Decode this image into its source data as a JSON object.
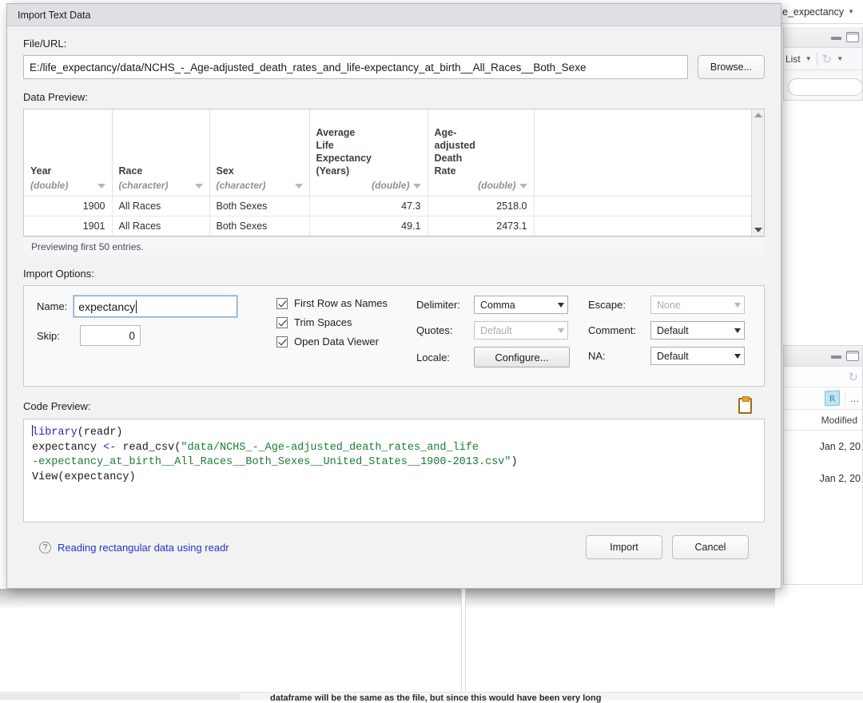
{
  "background": {
    "top_tab_label": "e_expectancy",
    "env_toolbar_label": "List",
    "files_modified_header": "Modified",
    "files_rows": [
      "Jan 2, 20",
      "Jan 2, 20"
    ],
    "bottom_text": "dataframe will be the same as the file, but since this would have been very long",
    "r_logo_letter": "R",
    "more_dots": "..."
  },
  "dialog": {
    "title": "Import Text Data",
    "file_url": {
      "label": "File/URL:",
      "value": "E:/life_expectancy/data/NCHS_-_Age-adjusted_death_rates_and_life-expectancy_at_birth__All_Races__Both_Sexe",
      "browse_label": "Browse..."
    },
    "data_preview": {
      "label": "Data Preview:",
      "columns": [
        {
          "name": "Year",
          "type": "(double)",
          "numeric": true
        },
        {
          "name": "Race",
          "type": "(character)",
          "numeric": false
        },
        {
          "name": "Sex",
          "type": "(character)",
          "numeric": false
        },
        {
          "name": "Average\nLife\nExpectancy\n(Years)",
          "type": "(double)",
          "numeric": true
        },
        {
          "name": "Age-\nadjusted\nDeath\nRate",
          "type": "(double)",
          "numeric": true
        }
      ],
      "rows": [
        {
          "year": "1900",
          "race": "All Races",
          "sex": "Both Sexes",
          "life_expectancy": "47.3",
          "death_rate": "2518.0"
        },
        {
          "year": "1901",
          "race": "All Races",
          "sex": "Both Sexes",
          "life_expectancy": "49.1",
          "death_rate": "2473.1"
        }
      ],
      "footer": "Previewing first 50 entries."
    },
    "import_options": {
      "label": "Import Options:",
      "name_label": "Name:",
      "name_value": "expectancy",
      "skip_label": "Skip:",
      "skip_value": "0",
      "checkboxes": [
        {
          "label": "First Row as Names",
          "checked": true
        },
        {
          "label": "Trim Spaces",
          "checked": true
        },
        {
          "label": "Open Data Viewer",
          "checked": true
        }
      ],
      "delimiter_label": "Delimiter:",
      "delimiter_value": "Comma",
      "quotes_label": "Quotes:",
      "quotes_value": "Default",
      "locale_label": "Locale:",
      "locale_button": "Configure...",
      "escape_label": "Escape:",
      "escape_value": "None",
      "comment_label": "Comment:",
      "comment_value": "Default",
      "na_label": "NA:",
      "na_value": "Default"
    },
    "code_preview": {
      "label": "Code Preview:",
      "line1_fn": "library",
      "line1_rest": "(readr)",
      "line2_var": "expectancy ",
      "line2_op": "<- ",
      "line2_fn": "read_csv",
      "line2_paren_open": "(",
      "line2_str_a": "\"data/NCHS_-_Age-adjusted_death_rates_and_life",
      "line3_str_b": "-expectancy_at_birth__All_Races__Both_Sexes__United_States__1900-2013.csv\"",
      "line3_paren_close": ")",
      "line4": "View(expectancy)"
    },
    "footer": {
      "help_text": "Reading rectangular data using readr",
      "help_icon": "?",
      "import_label": "Import",
      "cancel_label": "Cancel"
    }
  }
}
